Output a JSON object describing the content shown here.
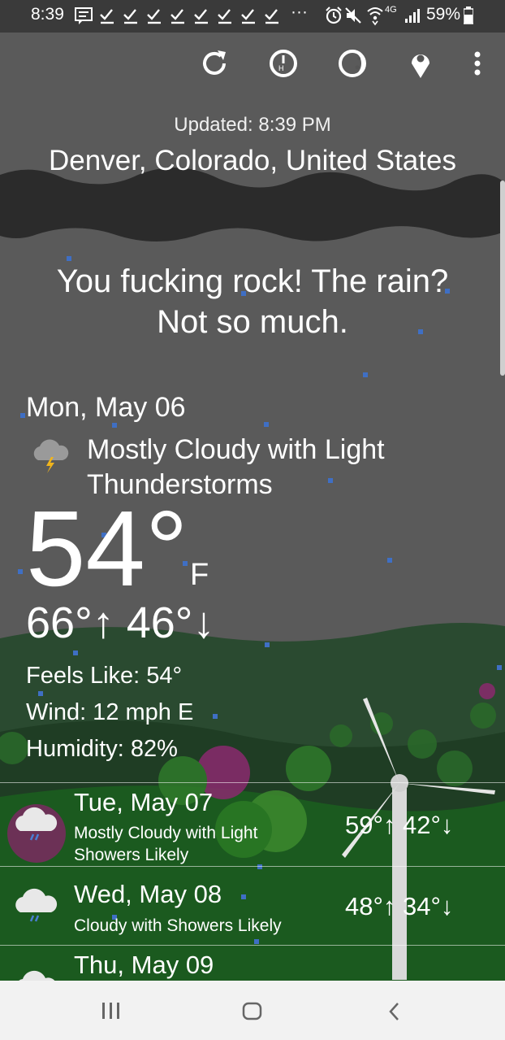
{
  "status_bar": {
    "time": "8:39",
    "more": "···",
    "network": "4G",
    "battery": "59%"
  },
  "toolbar": {
    "icons": [
      "refresh-icon",
      "history-icon",
      "moon-phase-icon",
      "location-pin-icon",
      "more-vert-icon"
    ]
  },
  "header": {
    "updated": "Updated: 8:39 PM",
    "location": "Denver, Colorado, United States"
  },
  "headline": {
    "line1": "You fucking rock! The rain?",
    "line2": "Not so much."
  },
  "today": {
    "date": "Mon, May 06",
    "condition_line1": "Mostly Cloudy with Light",
    "condition_line2": "Thunderstorms",
    "temperature": "54°",
    "unit": "F",
    "high": "66°",
    "low": "46°",
    "feels_like": "Feels Like: 54°",
    "wind": "Wind: 12 mph E",
    "humidity": "Humidity: 82%"
  },
  "forecast": [
    {
      "day": "Tue, May 07",
      "condition_line1": "Mostly Cloudy with Light",
      "condition_line2": "Showers Likely",
      "high": "59°",
      "low": "42°"
    },
    {
      "day": "Wed, May 08",
      "condition_line1": "Cloudy with Showers Likely",
      "high": "48°",
      "low": "34°"
    },
    {
      "day": "Thu, May 09"
    }
  ],
  "colors": {
    "sky": "#5a5a5a",
    "cloud_band": "#2b2b2b",
    "hills": "#28472e",
    "rain_drop": "#3f6fc4",
    "nav_bar": "#f2f2f2"
  }
}
